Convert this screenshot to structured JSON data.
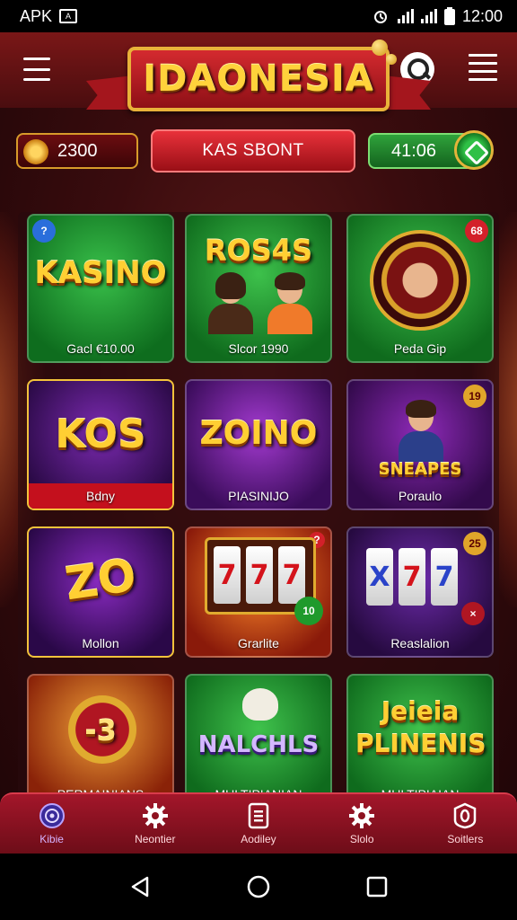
{
  "status_bar": {
    "carrier_label": "APK",
    "time": "12:00"
  },
  "header": {
    "title": "IDAONESIA"
  },
  "info_row": {
    "coins": "2300",
    "center_label": "KAS SBONT",
    "time_value": "41:06"
  },
  "games": [
    {
      "title_art": "KASINO",
      "label": "Gacl €10.00",
      "badge": ""
    },
    {
      "title_art": "ROS4S",
      "label": "Slcor 1990",
      "badge": ""
    },
    {
      "title_art": "",
      "label": "Peda Gip",
      "badge": "68"
    },
    {
      "title_art": "KOS",
      "label": "Bdny",
      "badge": ""
    },
    {
      "title_art": "ZOINO",
      "label": "PIASINIJO",
      "badge": ""
    },
    {
      "title_art": "SNEAPES",
      "label": "Poraulo",
      "badge": "19"
    },
    {
      "title_art": "ZO",
      "label": "Mollon",
      "badge": ""
    },
    {
      "title_art": "",
      "label": "Grarlite",
      "badge": "10"
    },
    {
      "title_art": "",
      "label": "Reaslalion",
      "badge": "25"
    },
    {
      "title_art": "-3",
      "label": "PERMAINIANS",
      "badge": ""
    },
    {
      "title_art": "NALCHLS",
      "label": "MULTIPIANIAN",
      "badge": ""
    },
    {
      "title_art": "Jeieia PLINENIS",
      "label": "MULTIPIAIAN",
      "badge": ""
    }
  ],
  "bottom_nav": [
    {
      "label": "Kibie",
      "icon": "target-icon"
    },
    {
      "label": "Neontier",
      "icon": "gear-icon"
    },
    {
      "label": "Aodiley",
      "icon": "document-icon"
    },
    {
      "label": "Slolo",
      "icon": "gear-icon"
    },
    {
      "label": "Soitlers",
      "icon": "zero-badge-icon"
    }
  ],
  "colors": {
    "header_red": "#7a1717",
    "accent_gold": "#ffd23b",
    "nav_red": "#a3162a",
    "green": "#2fa23b"
  }
}
